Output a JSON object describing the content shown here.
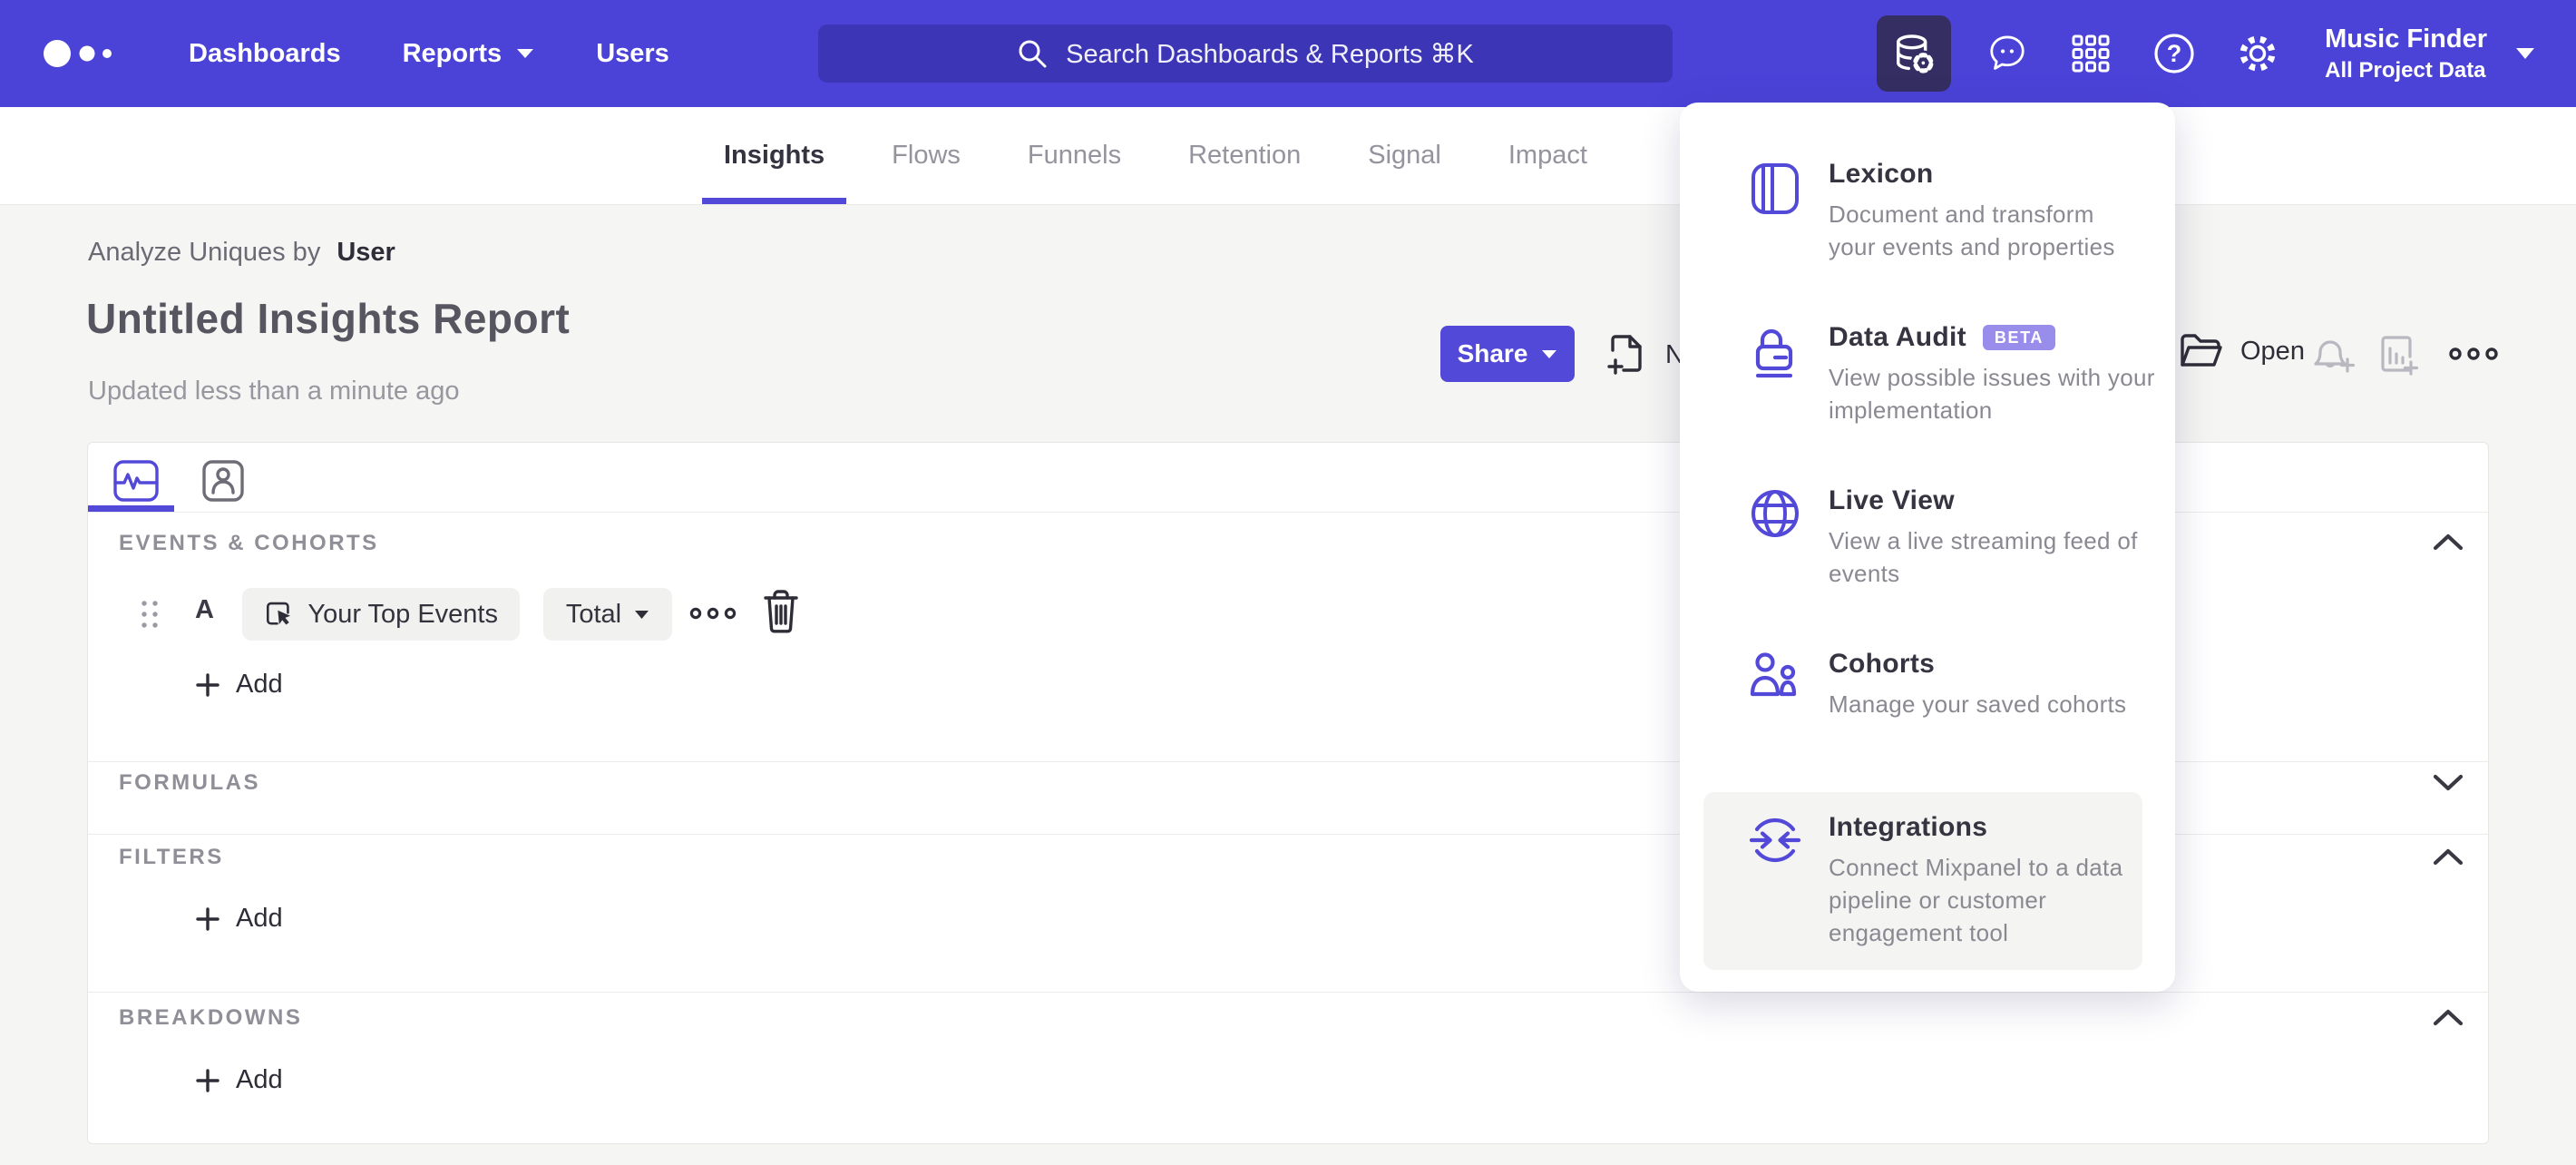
{
  "colors": {
    "brand_purple": "#4b43d8",
    "accent_purple": "#5349d8",
    "active_tile": "#342e63",
    "beta_badge": "#998dec",
    "page_bg": "#f5f5f3"
  },
  "navbar": {
    "links": [
      {
        "label": "Dashboards"
      },
      {
        "label": "Reports",
        "caret": "chevron-down-icon"
      },
      {
        "label": "Users"
      }
    ],
    "search_placeholder": "Search Dashboards & Reports ⌘K",
    "icons": [
      "data-management-icon",
      "support-chat-icon",
      "apps-grid-icon",
      "help-icon",
      "settings-gear-icon"
    ],
    "project": {
      "name": "Music Finder",
      "scope": "All Project Data"
    }
  },
  "report_tabs": [
    {
      "label": "Insights",
      "active": true
    },
    {
      "label": "Flows",
      "active": false
    },
    {
      "label": "Funnels",
      "active": false
    },
    {
      "label": "Retention",
      "active": false
    },
    {
      "label": "Signal",
      "active": false
    },
    {
      "label": "Impact",
      "active": false
    }
  ],
  "header": {
    "subtitle_prefix": "Analyze Uniques by",
    "subtitle_value": "User",
    "title": "Untitled Insights Report",
    "updated": "Updated less than a minute ago"
  },
  "toolbar": {
    "share_label": "Share",
    "new_label": "New",
    "open_label": "Open",
    "icons": [
      "document-plus-icon",
      "folder-open-icon",
      "bell-plus-icon",
      "chart-plus-icon",
      "ellipsis-icon"
    ]
  },
  "builder": {
    "view_tabs": [
      "insights-chart-tab-icon",
      "profile-tab-icon"
    ],
    "events": {
      "label": "EVENTS & COHORTS",
      "row": {
        "letter": "A",
        "event": "Your Top Events",
        "metric": "Total"
      },
      "add_label": "Add"
    },
    "formulas": {
      "label": "FORMULAS"
    },
    "filters": {
      "label": "FILTERS",
      "add_label": "Add"
    },
    "breakdowns": {
      "label": "BREAKDOWNS",
      "add_label": "Add"
    }
  },
  "menu": {
    "items": [
      {
        "icon": "lexicon-book-icon",
        "title": "Lexicon",
        "lines": [
          "Document and transform",
          "your events and properties"
        ]
      },
      {
        "icon": "data-audit-lock-icon",
        "title": "Data Audit",
        "badge": "BETA",
        "lines": [
          "View possible issues with your",
          "implementation"
        ]
      },
      {
        "icon": "live-view-globe-icon",
        "title": "Live View",
        "lines": [
          "View a live streaming feed of",
          "events"
        ]
      },
      {
        "icon": "cohorts-people-icon",
        "title": "Cohorts",
        "lines": [
          "Manage your saved cohorts"
        ]
      },
      {
        "icon": "integrations-sync-icon",
        "title": "Integrations",
        "highlighted": true,
        "lines": [
          "Connect Mixpanel to a data",
          "pipeline or customer",
          "engagement tool"
        ]
      }
    ]
  }
}
